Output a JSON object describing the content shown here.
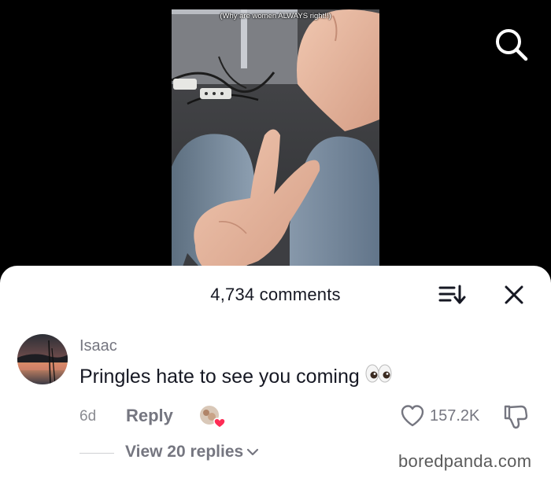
{
  "video": {
    "caption": "(Why are women ALWAYS right!!)"
  },
  "header": {
    "search_icon": "search-icon"
  },
  "comments": {
    "count_label": "4,734 comments",
    "sort_icon": "sort-icon",
    "close_icon": "close-icon"
  },
  "comment": {
    "username": "Isaac",
    "text": "Pringles hate to see you coming",
    "emoji": "eyes-emoji",
    "time": "6d",
    "reply_label": "Reply",
    "like_count": "157.2K",
    "view_replies_label": "View 20 replies"
  },
  "watermark": "boredpanda.com",
  "colors": {
    "text_primary": "#161823",
    "text_secondary": "#757680",
    "heart_red": "#fe2c55"
  }
}
